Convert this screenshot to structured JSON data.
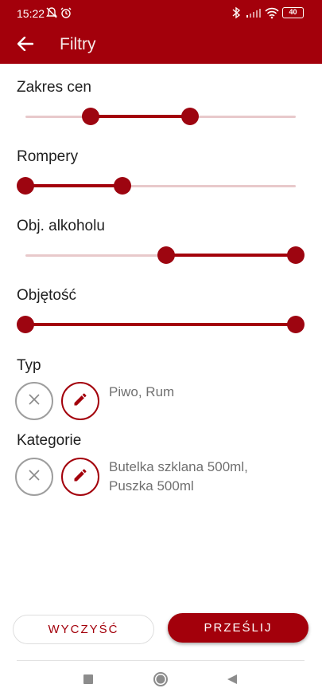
{
  "status_bar": {
    "time": "15:22",
    "battery": "40",
    "icons": [
      "mute-bell-icon",
      "alarm-icon",
      "bluetooth-icon",
      "signal-icon",
      "wifi-icon",
      "battery-icon"
    ]
  },
  "app_bar": {
    "title": "Filtry",
    "back_icon": "arrow-left-icon"
  },
  "colors": {
    "primary": "#a3000b",
    "rail": "#e8c9cb",
    "value_text": "#707070",
    "clear_ring": "#9e9e9e"
  },
  "filters": {
    "price": {
      "label": "Zakres cen",
      "range_fraction": [
        0.24,
        0.61
      ]
    },
    "rompery": {
      "label": "Rompery",
      "range_fraction": [
        0.0,
        0.36
      ]
    },
    "alcohol": {
      "label": "Obj. alkoholu",
      "range_fraction": [
        0.52,
        1.0
      ]
    },
    "volume": {
      "label": "Objętość",
      "range_fraction": [
        0.0,
        1.0
      ]
    }
  },
  "type_filter": {
    "label": "Typ",
    "value": "Piwo, Rum"
  },
  "category_filter": {
    "label": "Kategorie",
    "value_line1": "Butelka szklana 500ml,",
    "value_line2": "Puszka 500ml"
  },
  "actions": {
    "clear_label": "WYCZYŚĆ",
    "submit_label": "PRZEŚLIJ"
  },
  "system_nav": {
    "icons": [
      "recents-square-icon",
      "home-circle-icon",
      "back-triangle-icon"
    ]
  }
}
